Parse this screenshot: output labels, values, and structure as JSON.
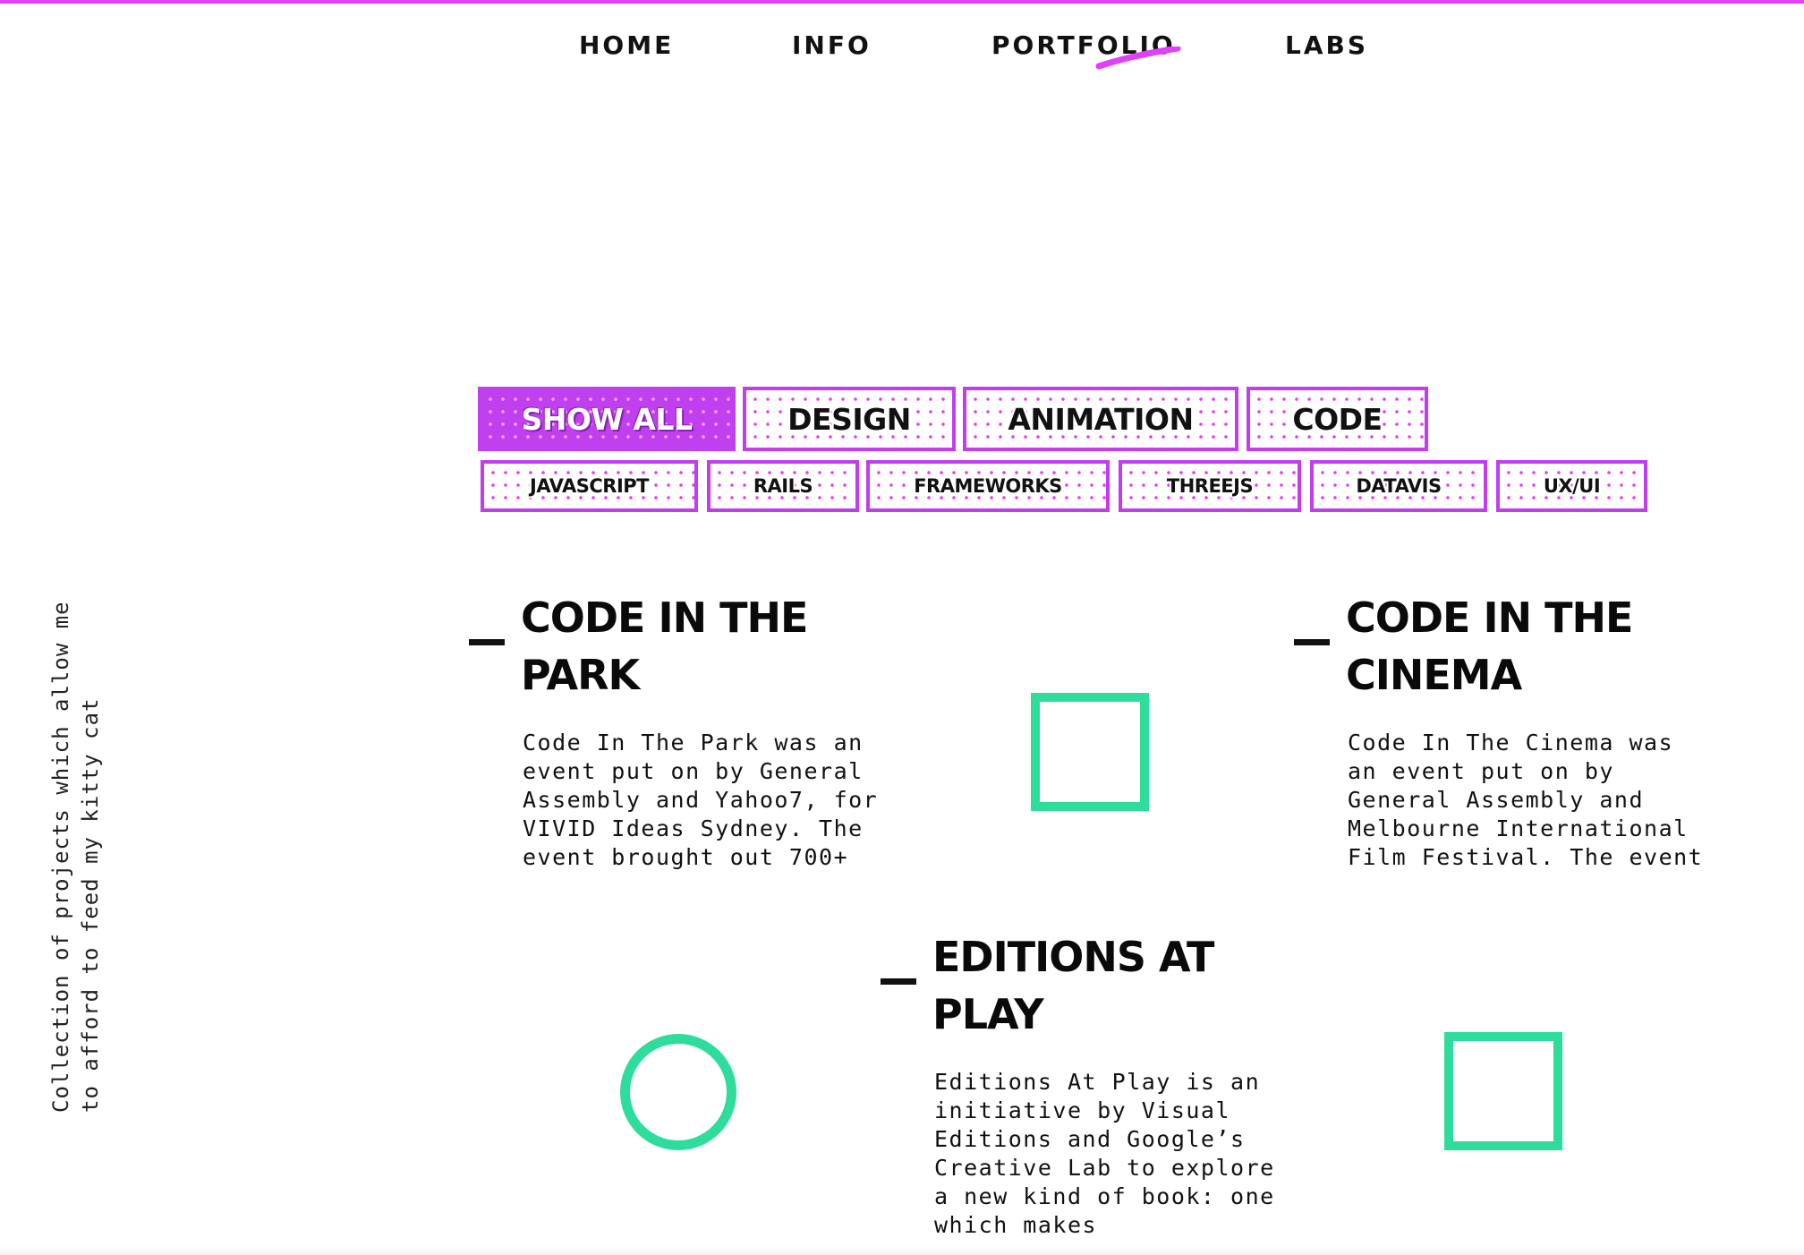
{
  "nav": {
    "items": [
      {
        "label": "HOME"
      },
      {
        "label": "INFO"
      },
      {
        "label": "PORTFOLIO",
        "active": true
      },
      {
        "label": "LABS"
      }
    ],
    "accent_color": "#e040fb"
  },
  "filters": {
    "primary": [
      {
        "label": "SHOW ALL",
        "active": true
      },
      {
        "label": "DESIGN"
      },
      {
        "label": "ANIMATION"
      },
      {
        "label": "CODE"
      }
    ],
    "secondary": [
      {
        "label": "JAVASCRIPT"
      },
      {
        "label": "RAILS"
      },
      {
        "label": "FRAMEWORKS"
      },
      {
        "label": "THREEJS"
      },
      {
        "label": "DATAVIS"
      },
      {
        "label": "UX/UI"
      }
    ]
  },
  "side_text": "Collection of projects which allow me to afford to feed my kitty cat",
  "projects": [
    {
      "title": "CODE IN THE PARK",
      "description": "Code In The Park was an event put on by General Assembly and Yahoo7, for VIVID Ideas Sydney. The event brought out 700+"
    },
    {
      "title": "CODE IN THE CINEMA",
      "description": "Code In The Cinema was an event put on by General Assembly and Melbourne International Film Festival. The event"
    },
    {
      "title": "EDITIONS AT PLAY",
      "description": "Editions At Play is an initiative by Visual Editions and Google’s Creative Lab to explore a new kind of book: one which makes"
    }
  ],
  "colors": {
    "accent": "#c43cf0",
    "shape": "#2edc9c"
  },
  "icons": [
    "square-outline-icon",
    "circle-outline-icon"
  ]
}
